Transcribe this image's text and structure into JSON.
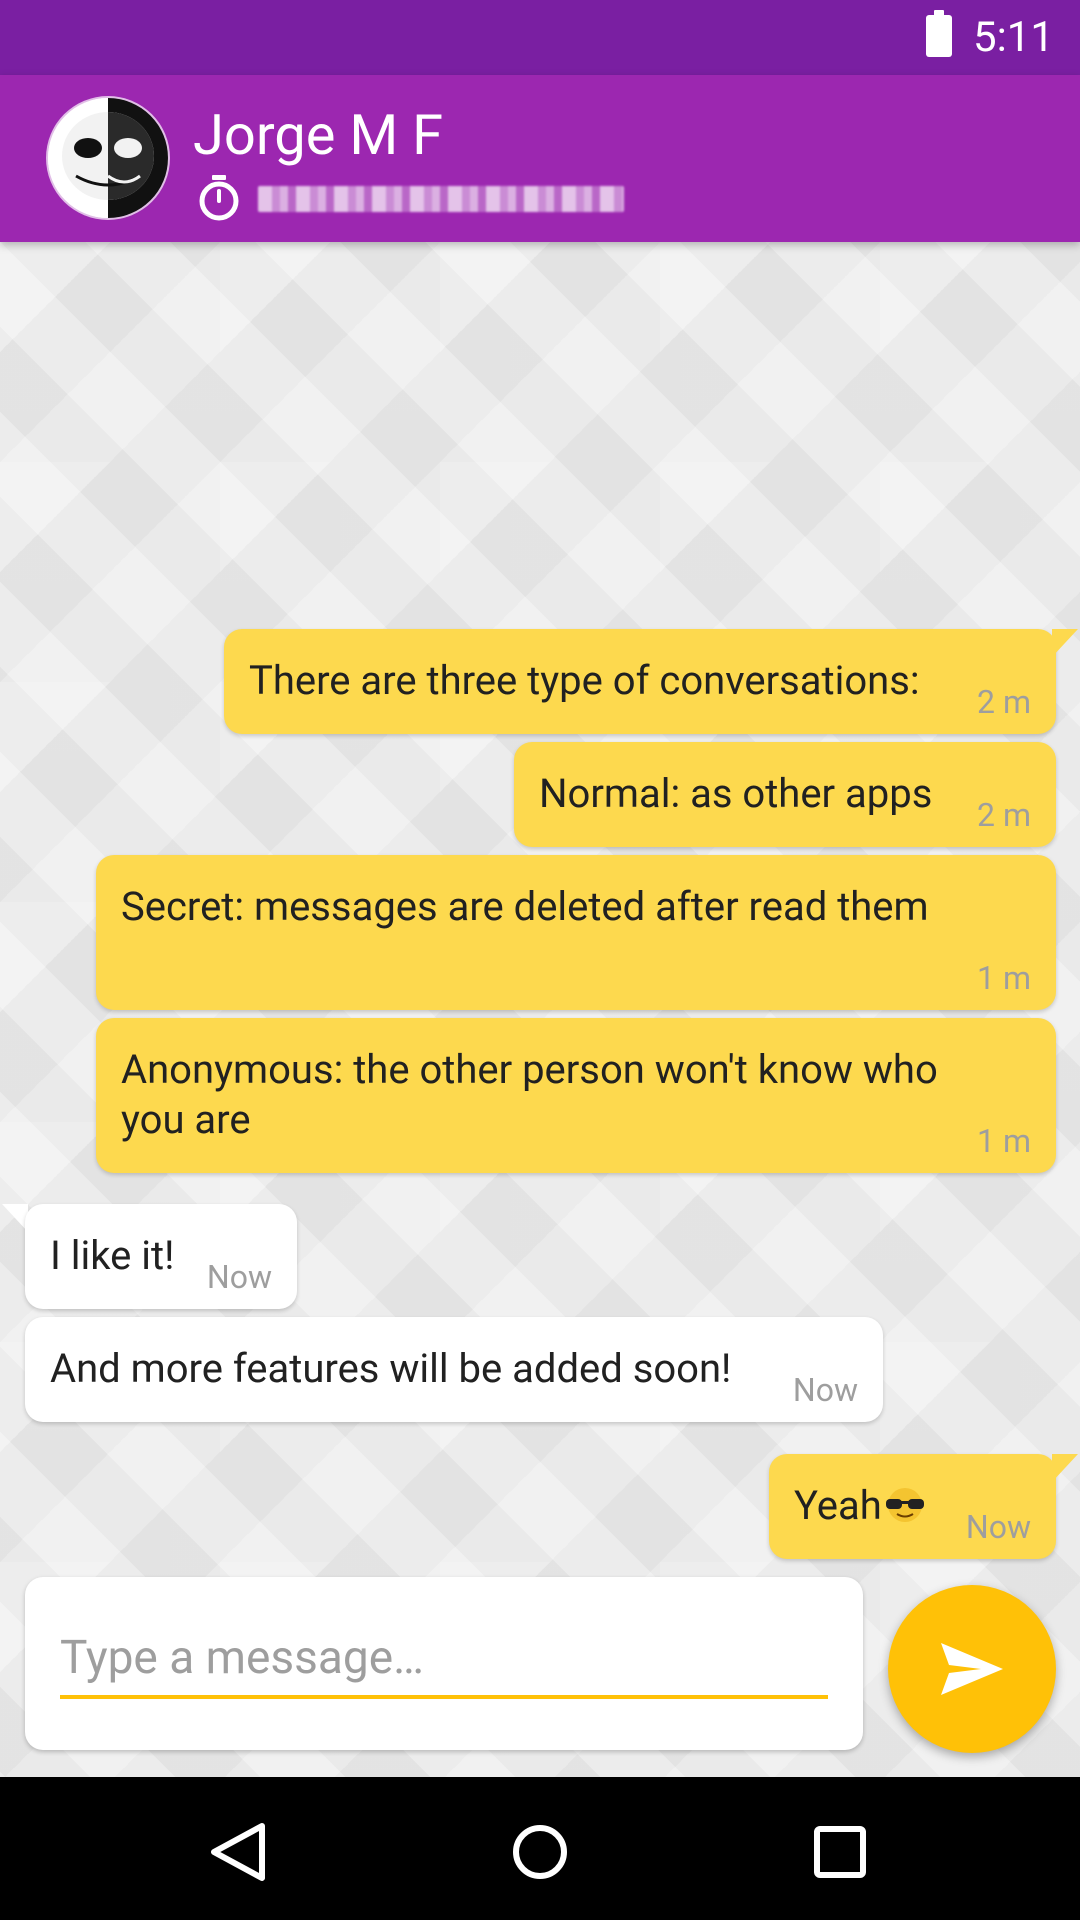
{
  "status_bar": {
    "time": "5:11",
    "battery_icon": "battery-full-icon"
  },
  "header": {
    "name": "Jorge M F",
    "avatar_icon": "jack-skellington-avatar",
    "timer_icon": "stopwatch-icon",
    "phone_blurred": true
  },
  "messages": [
    {
      "direction": "out",
      "text": "There are three type of conversations:",
      "time": "2 m"
    },
    {
      "direction": "out",
      "text": "Normal: as other apps",
      "time": "2 m"
    },
    {
      "direction": "out",
      "text": "Secret: messages are deleted after read them",
      "time": "1 m"
    },
    {
      "direction": "out",
      "text": "Anonymous: the other person won't know who you are",
      "time": "1 m"
    },
    {
      "direction": "in",
      "text": "I like it!",
      "time": "Now"
    },
    {
      "direction": "in",
      "text": "And more features will be added soon!",
      "time": "Now"
    },
    {
      "direction": "out",
      "text": "Yeah",
      "emoji": "sunglasses-emoji",
      "time": "Now"
    }
  ],
  "composer": {
    "placeholder": "Type a message…",
    "value": ""
  },
  "send_button": {
    "icon": "send-icon",
    "color": "#ffc107"
  },
  "nav": {
    "back_icon": "back-icon",
    "home_icon": "home-icon",
    "recents_icon": "recents-icon"
  },
  "colors": {
    "status_bar": "#7a1fa2",
    "app_bar": "#9c27b0",
    "bubble_out": "#fdd94e",
    "bubble_in": "#ffffff",
    "accent": "#ffc107"
  }
}
